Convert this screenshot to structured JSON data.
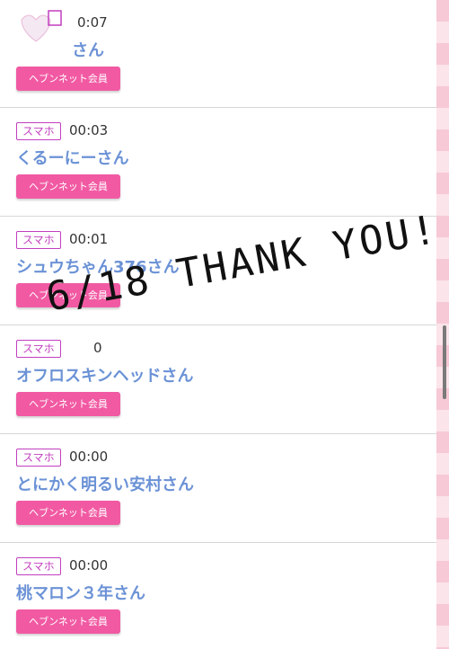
{
  "entries": [
    {
      "device": "",
      "time": "0:07",
      "name": "さん",
      "member_label": "ヘブンネット会員"
    },
    {
      "device": "スマホ",
      "time": "00:03",
      "name": "くるーにーさん",
      "member_label": "ヘブンネット会員"
    },
    {
      "device": "スマホ",
      "time": "00:01",
      "name": "シュウちゃん376さん",
      "member_label": "ヘブンネット会員"
    },
    {
      "device": "スマホ",
      "time": "0",
      "name": "オフロスキンヘッドさん",
      "member_label": "ヘブンネット会員"
    },
    {
      "device": "スマホ",
      "time": "00:00",
      "name": "とにかく明るい安村さん",
      "member_label": "ヘブンネット会員"
    },
    {
      "device": "スマホ",
      "time": "00:00",
      "name": "桃マロン３年さん",
      "member_label": "ヘブンネット会員"
    }
  ],
  "overlay": {
    "text": "6/18 THANK YOU!"
  },
  "colors": {
    "accent": "#f15aa3",
    "badge": "#c23fbf",
    "name": "#6b92d6"
  }
}
